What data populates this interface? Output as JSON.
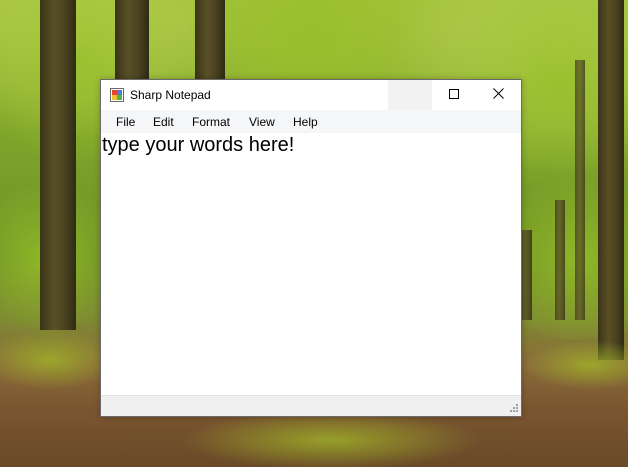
{
  "window": {
    "title": "Sharp Notepad",
    "controls": {
      "minimize_icon": "minimize-icon",
      "maximize_icon": "maximize-icon",
      "close_icon": "close-icon"
    }
  },
  "menu": {
    "items": [
      {
        "label": "File"
      },
      {
        "label": "Edit"
      },
      {
        "label": "Format"
      },
      {
        "label": "View"
      },
      {
        "label": "Help"
      }
    ]
  },
  "editor": {
    "text": "type your words here!"
  },
  "colors": {
    "window_bg": "#ffffff",
    "menubar_bg": "#f5f6f8",
    "statusbar_bg": "#f0f0f0",
    "text": "#000000"
  }
}
